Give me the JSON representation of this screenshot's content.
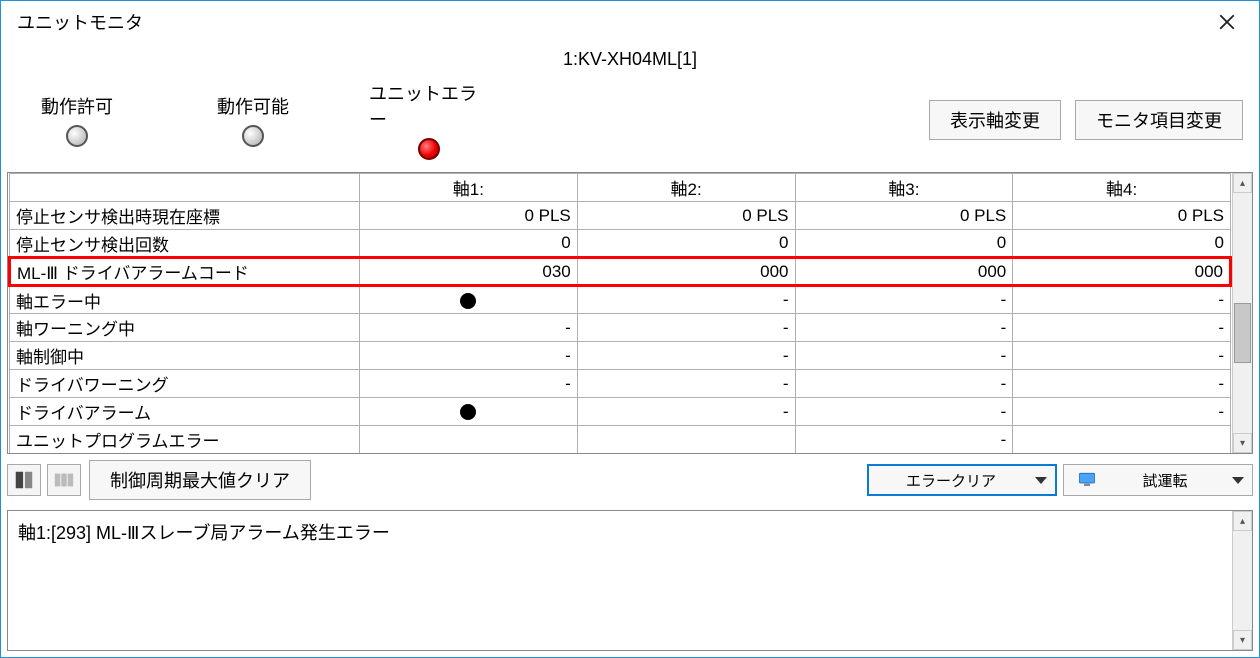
{
  "window": {
    "title": "ユニットモニタ",
    "device": "1:KV-XH04ML[1]"
  },
  "status": {
    "permit": {
      "label": "動作許可",
      "on": false
    },
    "enable": {
      "label": "動作可能",
      "on": false
    },
    "error": {
      "label": "ユニットエラー",
      "on": true
    },
    "btn_axis_change": "表示軸変更",
    "btn_items_change": "モニタ項目変更"
  },
  "table": {
    "headers": [
      "",
      "軸1:",
      "軸2:",
      "軸3:",
      "軸4:"
    ],
    "rows": [
      {
        "label": "停止センサ検出時現在座標",
        "vals": [
          "0 PLS",
          "0 PLS",
          "0 PLS",
          "0 PLS"
        ],
        "clipped": true
      },
      {
        "label": "停止センサ検出回数",
        "vals": [
          "0",
          "0",
          "0",
          "0"
        ]
      },
      {
        "label": "ML-Ⅲ ドライバアラームコード",
        "vals": [
          "030",
          "000",
          "000",
          "000"
        ],
        "highlight": true
      },
      {
        "label": "軸エラー中",
        "vals": [
          "●",
          "-",
          "-",
          "-"
        ]
      },
      {
        "label": "軸ワーニング中",
        "vals": [
          "-",
          "-",
          "-",
          "-"
        ]
      },
      {
        "label": "軸制御中",
        "vals": [
          "-",
          "-",
          "-",
          "-"
        ]
      },
      {
        "label": "ドライバワーニング",
        "vals": [
          "-",
          "-",
          "-",
          "-"
        ]
      },
      {
        "label": "ドライバアラーム",
        "vals": [
          "●",
          "-",
          "-",
          "-"
        ]
      },
      {
        "label": "ユニットプログラムエラー",
        "vals": [
          "",
          "",
          "-",
          ""
        ]
      }
    ]
  },
  "toolbar": {
    "btn_clear_cycle": "制御周期最大値クリア",
    "dropdown_error_clear": "エラークリア",
    "dropdown_trial_run": "試運転"
  },
  "message": {
    "text": "軸1:[293] ML-Ⅲスレーブ局アラーム発生エラー"
  }
}
